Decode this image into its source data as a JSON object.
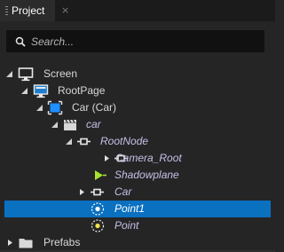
{
  "panel": {
    "tab_title": "Project",
    "close_glyph": "×"
  },
  "search": {
    "placeholder": "Search..."
  },
  "tree": [
    {
      "label": "Screen",
      "icon": "monitor-icon",
      "arrow": "expanded",
      "italic": false
    },
    {
      "label": "RootPage",
      "icon": "page-icon",
      "arrow": "expanded",
      "italic": false
    },
    {
      "label": "Car (Car)",
      "icon": "car-scene-icon",
      "arrow": "expanded",
      "italic": false
    },
    {
      "label": "car",
      "icon": "clapper-icon",
      "arrow": "expanded",
      "italic": true
    },
    {
      "label": "RootNode",
      "icon": "node-icon",
      "arrow": "expanded",
      "italic": true
    },
    {
      "label": "Camera_Root",
      "icon": "node-icon",
      "arrow": "collapsed",
      "italic": true
    },
    {
      "label": "Shadowplane",
      "icon": "mesh-icon",
      "arrow": "none",
      "italic": true
    },
    {
      "label": "Car",
      "icon": "node-icon",
      "arrow": "collapsed",
      "italic": true
    },
    {
      "label": "Point1",
      "icon": "point-light-icon",
      "arrow": "none",
      "italic": true,
      "selected": true
    },
    {
      "label": "Point",
      "icon": "point-light-icon",
      "arrow": "none",
      "italic": true
    },
    {
      "label": "Prefabs",
      "icon": "folder-icon",
      "arrow": "collapsed",
      "italic": false
    }
  ],
  "colors": {
    "selection": "#0a70c0",
    "background": "#252526",
    "italic_text": "#c5c0e6",
    "mesh_icon": "#a6e22e",
    "light_icon": "#f2e14c"
  }
}
